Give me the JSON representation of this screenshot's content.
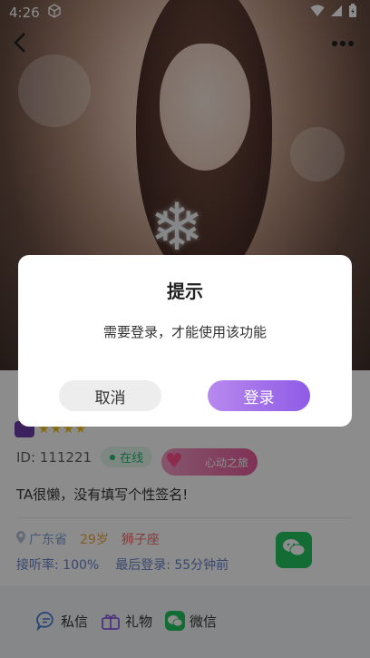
{
  "status_bar": {
    "time": "4:26"
  },
  "profile": {
    "name_initial": "...",
    "id_text": "ID: 111221",
    "online_label": "在线",
    "heart_badge_label": "心动之旅",
    "signature": "TA很懒，没有填写个性签名!",
    "location": "广东省",
    "age": "29岁",
    "zodiac": "狮子座",
    "answer_rate": "接听率: 100%",
    "last_login": "最后登录: 55分钟前",
    "colors": {
      "online": "#2bb673",
      "age": "#f0a640",
      "zodiac": "#ef6a6a",
      "accent": "#8f5be6"
    }
  },
  "bottom_bar": {
    "actions": [
      {
        "label": "私信",
        "icon": "chat-bubble-icon"
      },
      {
        "label": "礼物",
        "icon": "gift-icon"
      },
      {
        "label": "微信",
        "icon": "wechat-icon"
      }
    ]
  },
  "dialog": {
    "title": "提示",
    "message": "需要登录，才能使用该功能",
    "cancel_label": "取消",
    "login_label": "登录"
  }
}
